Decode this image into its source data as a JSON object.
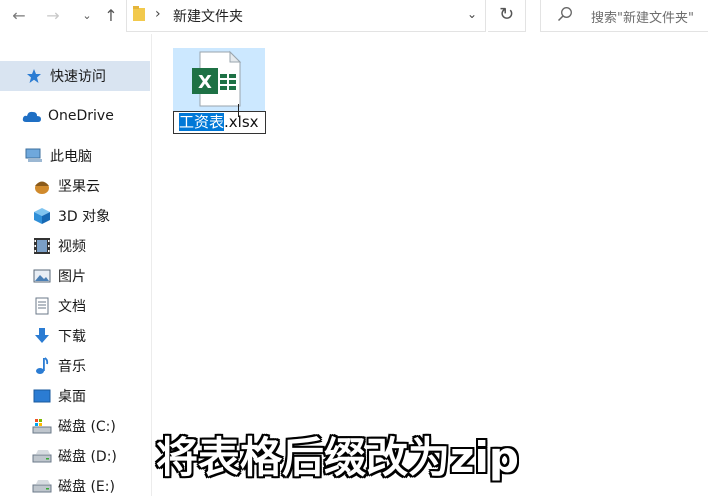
{
  "address_bar": {
    "back_glyph": "←",
    "forward_glyph": "→",
    "recent_glyph": "⌄",
    "up_glyph": "↑",
    "separator": "›",
    "breadcrumb": "新建文件夹",
    "dropdown_glyph": "⌄",
    "refresh_glyph": "↻",
    "search_placeholder": "搜索\"新建文件夹\""
  },
  "sidebar": {
    "items": [
      {
        "label": "快速访问",
        "icon": "star-icon",
        "selected": true
      },
      {
        "label": "OneDrive",
        "icon": "cloud-icon"
      },
      {
        "label": "此电脑",
        "icon": "computer-icon"
      },
      {
        "label": "坚果云",
        "icon": "nut-icon"
      },
      {
        "label": "3D 对象",
        "icon": "cube-icon"
      },
      {
        "label": "视频",
        "icon": "video-icon"
      },
      {
        "label": "图片",
        "icon": "picture-icon"
      },
      {
        "label": "文档",
        "icon": "document-icon"
      },
      {
        "label": "下载",
        "icon": "download-icon"
      },
      {
        "label": "音乐",
        "icon": "music-icon"
      },
      {
        "label": "桌面",
        "icon": "desktop-icon"
      },
      {
        "label": "磁盘 (C:)",
        "icon": "drive-icon"
      },
      {
        "label": "磁盘 (D:)",
        "icon": "drive-icon"
      },
      {
        "label": "磁盘 (E:)",
        "icon": "drive-icon"
      }
    ]
  },
  "file": {
    "icon": "excel-file-icon",
    "rename_selected": "工资表",
    "rename_rest": ".xlsx"
  },
  "subtitle": "将表格后缀改为zip",
  "colors": {
    "selection_blue": "#0078d7",
    "tile_highlight": "#cce8ff",
    "sidebar_selected": "#d9e4f1",
    "excel_green": "#1e7145"
  }
}
